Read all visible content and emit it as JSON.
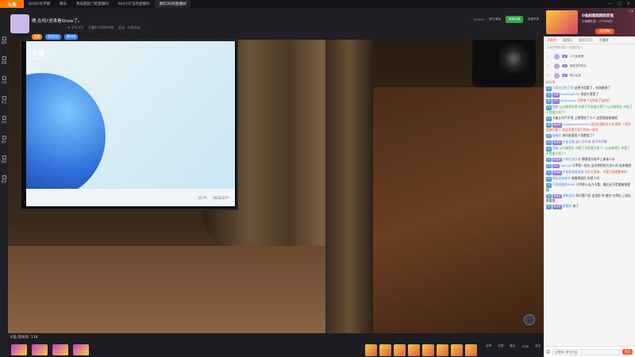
{
  "app": {
    "logo": "斗鱼"
  },
  "tabs": [
    {
      "label": "QUQU太平鹅"
    },
    {
      "label": "聊天"
    },
    {
      "label": "我去圈出门的直播间"
    },
    {
      "label": "Xlei小叮当的直播间"
    },
    {
      "label": "谢吃DD的直播间"
    }
  ],
  "window_controls": [
    "—",
    "□",
    "×"
  ],
  "leftnav": [
    {
      "label": "推荐"
    },
    {
      "label": "直播"
    },
    {
      "label": "分类"
    },
    {
      "label": "关注"
    },
    {
      "label": "游戏"
    },
    {
      "label": "娱乐"
    },
    {
      "label": "赛事"
    },
    {
      "label": "更多"
    }
  ],
  "header": {
    "title": "嗯,在吗?进来看Show了。",
    "meta": [
      "★ 171.4万",
      "已播1小时29分钟",
      "企业 · 斗鱼文化"
    ],
    "badge1": "主播",
    "badge2": "全站红名",
    "badge3": "第28名",
    "room_id": "9035??",
    "quality": "蓝光/原画",
    "vip_btn": "贵族开通",
    "report": "直播举报"
  },
  "video": {
    "brand": "斗鱼",
    "brand_sub": "DOUYU.COM",
    "taskbar_time": "11:??",
    "taskbar_date": "2024/1/??"
  },
  "bottombar": {
    "room_label": "斗鱼 房间号: 110",
    "icons": [
      "分享",
      "礼物",
      "鱼丸",
      "2336",
      "关注"
    ]
  },
  "chat": {
    "ad": {
      "title": "O鱼超超超超超变强",
      "sub": "小鱼爆礼物 ...???999亿!",
      "button": "点击领取",
      "tag": "广告"
    },
    "rank_tabs": [
      "贡献榜",
      "周排行",
      "观众(1万)",
      "主播榜"
    ],
    "rank_hint": "斗鱼严禁未成年人充值打赏 ?",
    "ranks": [
      {
        "no": "1",
        "badge": "★",
        "name": "小马某某唱"
      },
      {
        "no": "2",
        "badge": "★",
        "name": "鱼某某的粉丝"
      },
      {
        "no": "3",
        "badge": "★",
        "name": "御以后某"
      }
    ],
    "messages": [
      {
        "lv": "",
        "fan": "",
        "nick": "",
        "text": "机打的",
        "cls": "r"
      },
      {
        "lv": "30",
        "fan": "",
        "nick": "大哥太好吃了吧",
        "text": "这把不用看了，补场跟到了",
        "cls": ""
      },
      {
        "lv": "10",
        "fan": "专属",
        "nick": "mayflowerkk",
        "text": "你说大哥是了",
        "cls": ""
      },
      {
        "lv": "20",
        "fan": "牛牛",
        "nick": "westrange",
        "text": "马甲来了让你说了这场打",
        "cls": "r"
      },
      {
        "lv": "20",
        "fan": "",
        "nick": "我能",
        "text": "让分推荐队得 冲塔了不是要大哥了?让分推荐队 冲塔了不是要大哥了?",
        "cls": "g"
      },
      {
        "lv": "19",
        "fan": "",
        "nick": "",
        "text": "万能让叫气不得 上把得到了小人 这把直接推理吧",
        "cls": ""
      },
      {
        "lv": "18",
        "fan": "粉丝牌",
        "nick": "zzzzzzmmmmmm",
        "text": "这项目我的什么东西呢 人是不是被打要了 你这关是大哥不同有一样的",
        "cls": "r"
      },
      {
        "lv": "10",
        "fan": "",
        "nick": "碰撞头",
        "text": "你问说要用人类都变了？",
        "cls": ""
      },
      {
        "lv": "20",
        "fan": "粉丝牌",
        "nick": "长安无眠",
        "text": "这小马不说 孩子吗不喔",
        "cls": "p"
      },
      {
        "lv": "20",
        "fan": "",
        "nick": "我能",
        "text": "让分推荐队 冲塔了不是要大哥了? 让分推荐队 冲塔了不是要大哥了?",
        "cls": "g"
      },
      {
        "lv": "31",
        "fan": "粉丝牌",
        "nick": "沙特石油大佬",
        "text": "德德说为啥不上来拿人头",
        "cls": ""
      },
      {
        "lv": "19",
        "fan": "牛牛",
        "nick": "Yuanye",
        "text": "马甲第一优先 这次到把结力怎么办 这来看吧",
        "cls": ""
      },
      {
        "lv": "10",
        "fan": "粉丝牌",
        "nick": "中某某某某某某",
        "text": "为什么要来，不是大部就都有吗",
        "cls": "r"
      },
      {
        "lv": "20",
        "fan": "",
        "nick": "两回试加放中",
        "text": "收看得很仍 你是人吗",
        "cls": ""
      },
      {
        "lv": "10",
        "fan": "",
        "nick": "万物说我的4984",
        "text": "马甲那么去力不看，最后还不是要被推理倒",
        "cls": ""
      },
      {
        "lv": "50",
        "fan": "粉丝牌",
        "nick": "香格里拉",
        "text": "你们懂个屁 这里那 的 教学 在等队上场也能看看",
        "cls": ""
      },
      {
        "lv": "20",
        "fan": "粉丝牌",
        "nick": "素猫家",
        "text": "来了",
        "cls": ""
      }
    ],
    "input_placeholder": "这里输入聊天内容",
    "send": "发送"
  },
  "colors": {
    "accent": "#ff5a28",
    "brand": "#ff7a00"
  }
}
